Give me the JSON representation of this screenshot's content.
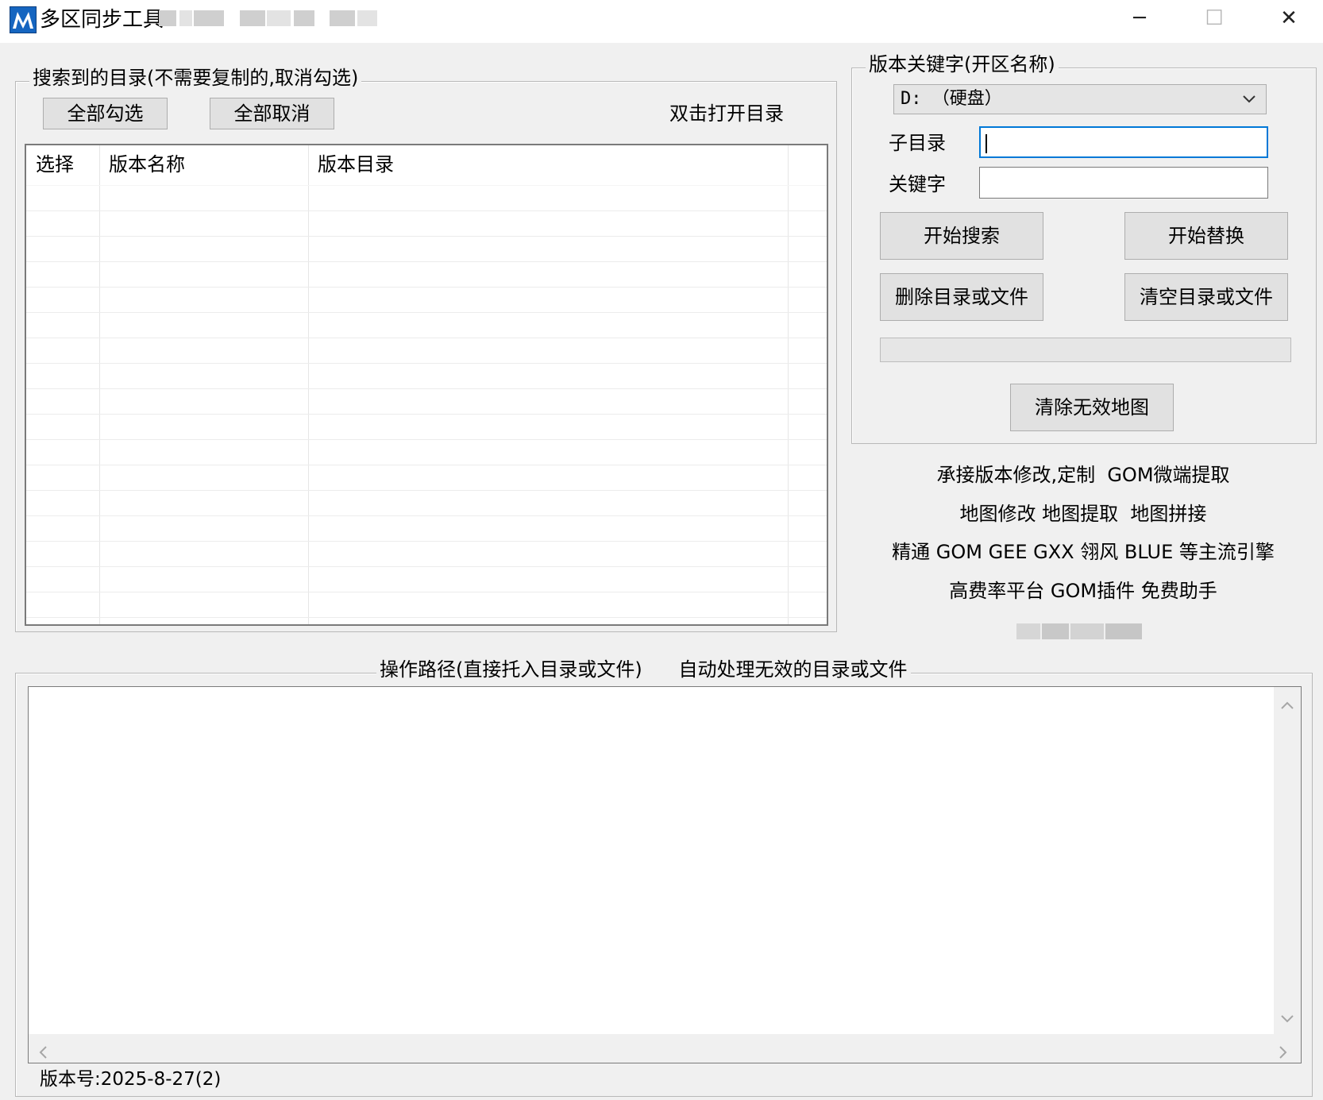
{
  "window": {
    "title": "多区同步工具",
    "minimize_glyph": "─",
    "maximize_glyph": "☐",
    "close_glyph": "✕"
  },
  "dir_group": {
    "legend": "搜索到的目录(不需要复制的,取消勾选)",
    "select_all_label": "全部勾选",
    "deselect_all_label": "全部取消",
    "hint": "双击打开目录",
    "columns": [
      "选择",
      "版本名称",
      "版本目录"
    ]
  },
  "keyword_group": {
    "legend": "版本关键字(开区名称)",
    "drive_selected": "D: （硬盘）",
    "subdir_label": "子目录",
    "subdir_value": "",
    "keyword_label": "关键字",
    "keyword_value": "",
    "start_search_label": "开始搜索",
    "start_replace_label": "开始替换",
    "delete_label": "删除目录或文件",
    "clear_label": "清空目录或文件",
    "progress": 0,
    "clear_maps_label": "清除无效地图"
  },
  "promo": {
    "line1": "承接版本修改,定制  GOM微端提取",
    "line2": "地图修改 地图提取  地图拼接",
    "line3": "精通 GOM GEE GXX 翎风 BLUE 等主流引擎",
    "line4": "高费率平台 GOM插件 免费助手"
  },
  "ops_group": {
    "legend": "操作路径(直接托入目录或文件)      自动处理无效的目录或文件",
    "log_text": ""
  },
  "version_text": "版本号:2025-8-27(2)",
  "icons": {
    "app": "app-logo-icon",
    "dropdown": "chevron-down-icon",
    "scroll_up": "scroll-up-arrow-icon",
    "scroll_down": "scroll-down-arrow-icon",
    "scroll_left": "scroll-left-arrow-icon",
    "scroll_right": "scroll-right-arrow-icon"
  },
  "colors": {
    "window_bg": "#f0f0f0",
    "focus_border": "#0078d7",
    "button_bg": "#e1e1e1"
  }
}
